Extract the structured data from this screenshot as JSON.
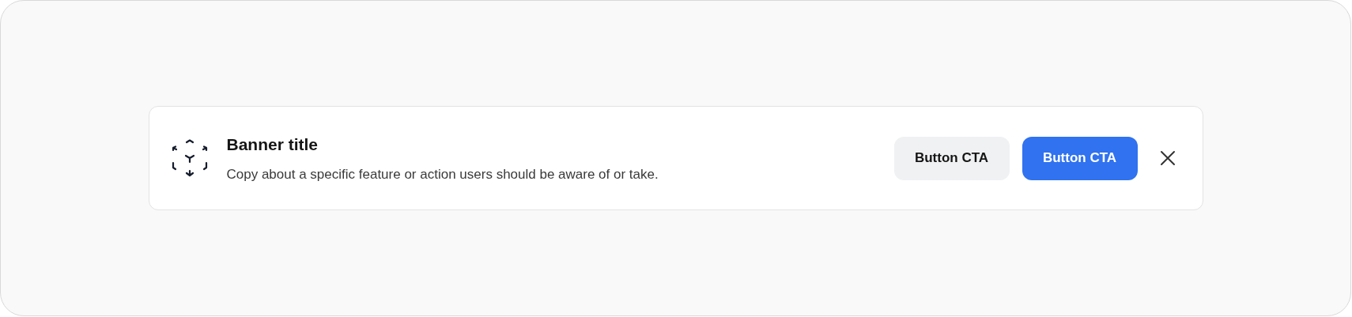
{
  "banner": {
    "title": "Banner title",
    "copy": "Copy about a specific feature or action users should be aware of or take.",
    "buttons": [
      {
        "label": "Button CTA",
        "kind": "secondary"
      },
      {
        "label": "Button CTA",
        "kind": "primary"
      }
    ]
  }
}
